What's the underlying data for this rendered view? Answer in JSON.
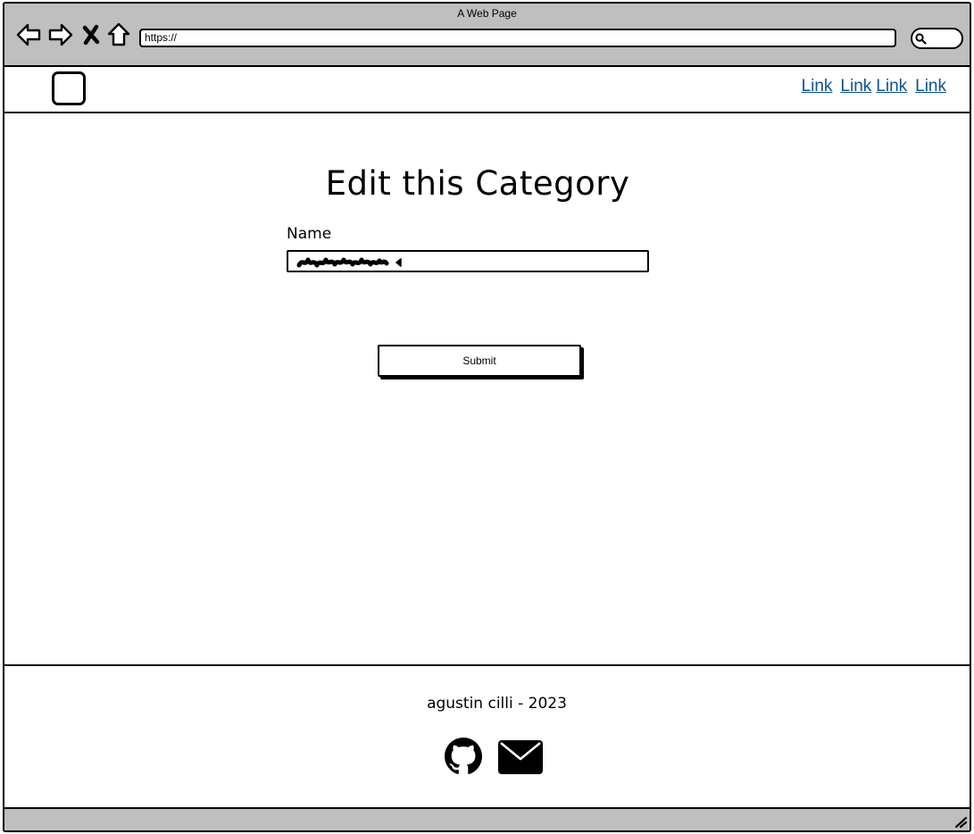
{
  "window": {
    "title": "A Web Page"
  },
  "browser": {
    "url": "https://",
    "icons": [
      "back-arrow-icon",
      "forward-arrow-icon",
      "close-x-icon",
      "home-icon",
      "search-icon"
    ]
  },
  "header": {
    "logo_icon": "square-logo-icon",
    "links": [
      "Link",
      "Link",
      "Link",
      "Link"
    ],
    "link_color": "#0b5394"
  },
  "main": {
    "title": "Edit this Category",
    "name_label": "Name",
    "submit_label": "Submit"
  },
  "footer": {
    "text": "agustin cilli - 2023",
    "icons": [
      "github-icon",
      "envelope-icon"
    ]
  },
  "colors": {
    "chrome": "#bfbfbf",
    "background": "#ffffff",
    "ink": "#000000"
  }
}
